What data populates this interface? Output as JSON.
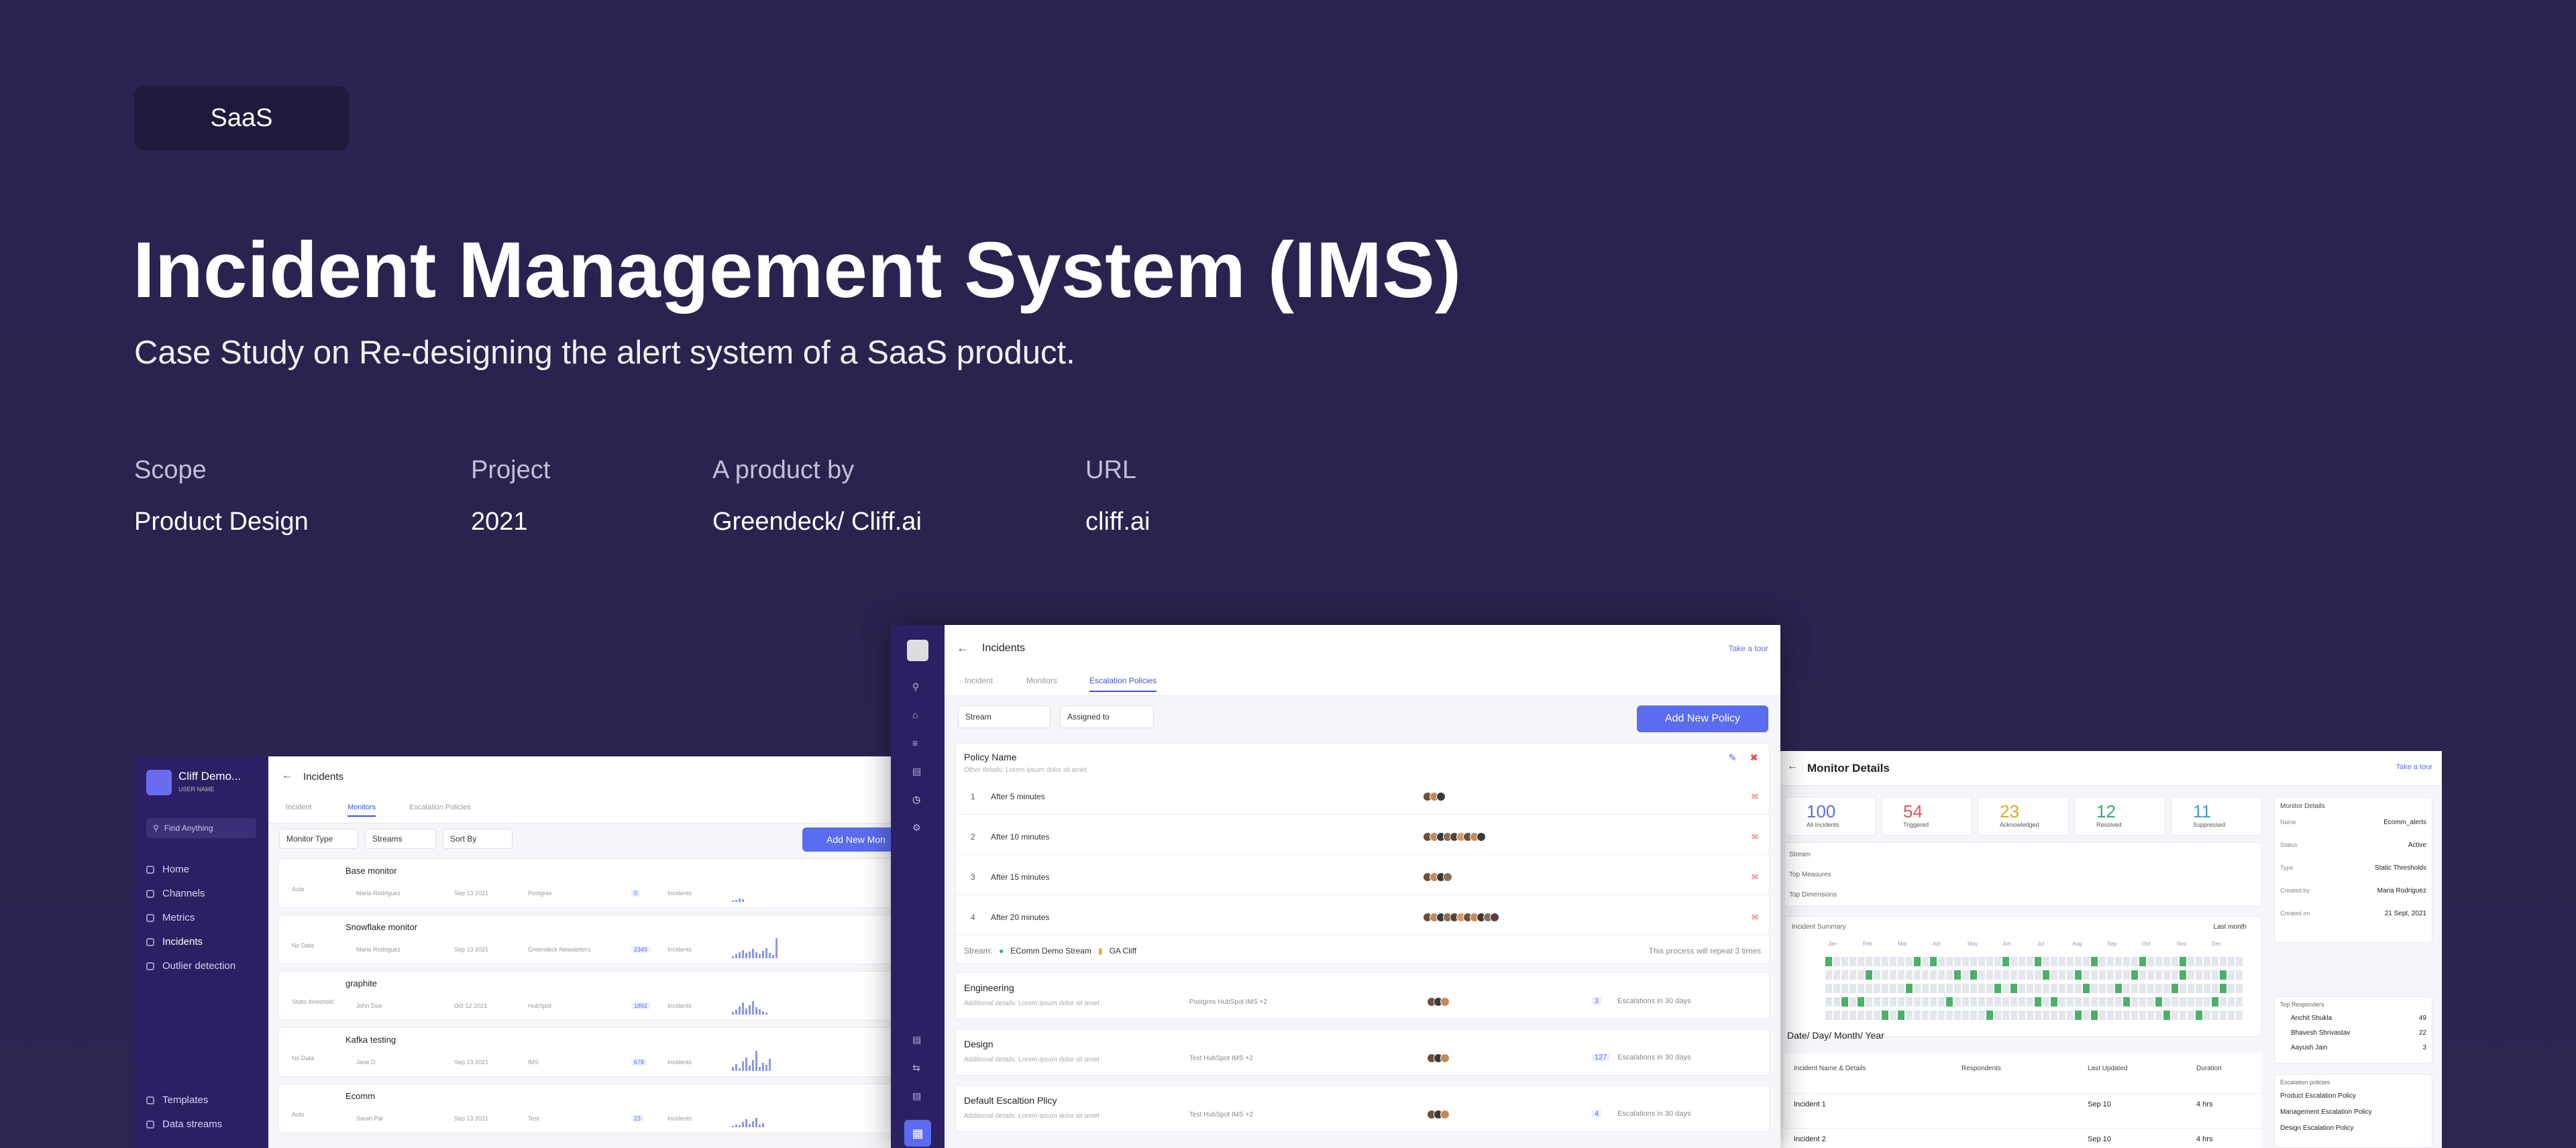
{
  "tag": "SaaS",
  "title": "Incident Management System (IMS)",
  "subtitle": "Case Study on Re-designing the alert system of a SaaS product.",
  "meta": [
    {
      "label": "Scope",
      "value": "Product Design"
    },
    {
      "label": "Project",
      "value": "2021"
    },
    {
      "label": "A product by",
      "value": "Greendeck/ Cliff.ai"
    },
    {
      "label": "URL",
      "value": "cliff.ai"
    }
  ],
  "left_screen": {
    "workspace": "Cliff Demo...",
    "user": "USER NAME",
    "find": "Find Anything",
    "nav": [
      "Home",
      "Channels",
      "Metrics",
      "Incidents",
      "Outlier detection"
    ],
    "nav_bottom": [
      "Templates",
      "Data streams"
    ],
    "page_title": "Incidents",
    "tabs": [
      "Incident",
      "Monitors",
      "Escalation Policies"
    ],
    "filters": [
      "Monitor Type",
      "Streams",
      "Sort By"
    ],
    "add_button": "Add New Mon",
    "monitors": [
      {
        "type": "Auto",
        "name": "Base monitor",
        "owner": "Maria Rodriguez",
        "date": "Sep 13 2021",
        "source": "Postgres",
        "count": "0",
        "label": "Incidents"
      },
      {
        "type": "No Data",
        "name": "Snowflake monitor",
        "owner": "Maria Rodriguez",
        "date": "Sep 13 2021",
        "source": "Greendeck Newsletters",
        "count": "2349",
        "label": "Incidents"
      },
      {
        "type": "Static threshold",
        "name": "graphite",
        "owner": "John Doe",
        "date": "Oct 12 2021",
        "source": "HubSpot",
        "count": "1892",
        "label": "Incidents"
      },
      {
        "type": "No Data",
        "name": "Kafka testing",
        "owner": "Jane D.",
        "date": "Sep 13 2021",
        "source": "IMS",
        "count": "678",
        "label": "Incidents"
      },
      {
        "type": "Auto",
        "name": "Ecomm",
        "owner": "Sarah Pal",
        "date": "Sep 13 2021",
        "source": "Test",
        "count": "23",
        "label": "Incidents"
      }
    ]
  },
  "mid_screen": {
    "page_title": "Incidents",
    "tour": "Take a tour",
    "tabs": [
      "Incident",
      "Monitors",
      "Escalation Policies"
    ],
    "filters": [
      "Stream",
      "Assigned to"
    ],
    "add_button": "Add New Policy",
    "policy_name": "Policy Name",
    "policy_desc": "Other details: Lorem ipsum dolor sit amet",
    "steps": [
      {
        "n": "1",
        "label": "After 5 minutes"
      },
      {
        "n": "2",
        "label": "After 10 minutes"
      },
      {
        "n": "3",
        "label": "After 15 minutes"
      },
      {
        "n": "4",
        "label": "After 20 minutes"
      }
    ],
    "stream_label": "Stream:",
    "stream_a": "EComm Demo Stream",
    "stream_b": "GA Cliff",
    "repeat": "This process will repeat 3 times",
    "policies": [
      {
        "name": "Engineering",
        "desc": "Additional details: Lorem ipsum dolor sit amet",
        "sources": "Postgres  HubSpot  IMS  +2",
        "count": "3",
        "esc": "Escalations in 30 days"
      },
      {
        "name": "Design",
        "desc": "Additional details: Lorem ipsum dolor sit amet",
        "sources": "Test  HubSpot  IMS  +2",
        "count": "127",
        "esc": "Escalations in 30 days"
      },
      {
        "name": "Default Escaltion Plicy",
        "desc": "Additional details: Lorem ipsum dolor sit amet",
        "sources": "Test  HubSpot  IMS  +2",
        "count": "4",
        "esc": "Escalations in 30 days"
      }
    ]
  },
  "right_screen": {
    "page_title": "Monitor Details",
    "tour": "Take a tour",
    "stats": [
      {
        "value": "100",
        "label": "All Incidents",
        "color": "#5b6cf0"
      },
      {
        "value": "54",
        "label": "Triggered",
        "color": "#e55353"
      },
      {
        "value": "23",
        "label": "Acknowledged",
        "color": "#e6a817"
      },
      {
        "value": "12",
        "label": "Resolved",
        "color": "#2fae6b"
      },
      {
        "value": "11",
        "label": "Suppressed",
        "color": "#3aa0d8"
      }
    ],
    "rows": [
      "Stream",
      "Top Measures",
      "Top Dimensions"
    ],
    "summary_title": "Incident Summary",
    "summary_range": "Last month",
    "months": [
      "Jan",
      "Feb",
      "Mar",
      "Apr",
      "May",
      "Jun",
      "Jul",
      "Aug",
      "Sep",
      "Oct",
      "Nov",
      "Dec"
    ],
    "table_head": [
      "Incident Name & Details",
      "Respondents",
      "Last Updated",
      "Duration"
    ],
    "period": "Date/ Day/ Month/ Year",
    "incidents": [
      {
        "name": "Incident 1",
        "updated": "Sep 10",
        "duration": "4 hrs"
      },
      {
        "name": "Incident 2",
        "updated": "Sep 10",
        "duration": "4 hrs"
      }
    ],
    "details_title": "Monitor Details",
    "details": [
      {
        "k": "Name",
        "v": "Ecomm_alerts"
      },
      {
        "k": "Status",
        "v": "Active"
      },
      {
        "k": "Type",
        "v": "Static Thresholds"
      },
      {
        "k": "Created by",
        "v": "Maria Rodriguez"
      },
      {
        "k": "Created on",
        "v": "21 Sept, 2021"
      }
    ],
    "responders_title": "Top Responders",
    "responders": [
      {
        "name": "Anchit Shukla",
        "n": "49"
      },
      {
        "name": "Bhavesh Shrivastav",
        "n": "22"
      },
      {
        "name": "Aayush Jain",
        "n": "3"
      }
    ],
    "policies_title": "Escalation policies",
    "policies": [
      "Product Escalation Policy",
      "Management Escalation Policy",
      "Design Escalation Policy"
    ]
  }
}
